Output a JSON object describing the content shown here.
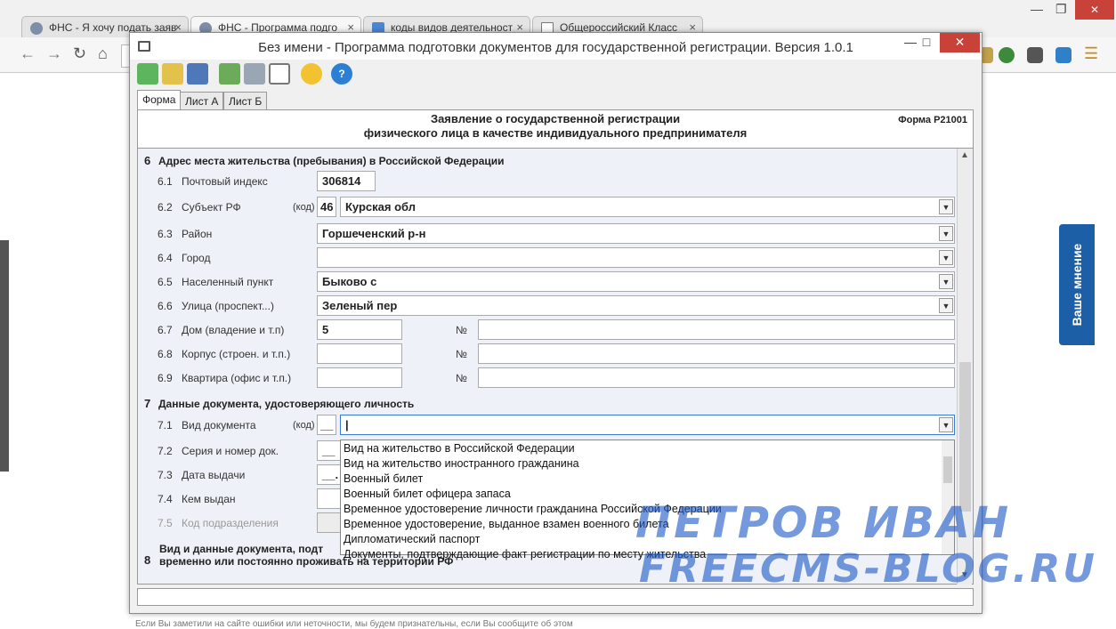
{
  "browser": {
    "tabs": [
      {
        "title": "ФНС - Я хочу подать заяв",
        "close": "×"
      },
      {
        "title": "ФНС - Программа подго",
        "close": "×"
      },
      {
        "title": "коды видов деятельност",
        "close": "×"
      },
      {
        "title": "Общероссийский Класс",
        "close": "×"
      }
    ],
    "window_controls": {
      "minimize": "—",
      "restore": "❐"
    }
  },
  "side_widget": {
    "label": "Ваше мнение"
  },
  "footer_note": "Если Вы заметили на сайте ошибки или неточности, мы будем признательны, если Вы сообщите об этом",
  "app": {
    "title": "Без имени - Программа подготовки документов для государственной регистрации. Версия 1.0.1",
    "window_buttons": {
      "minimize": "—",
      "maximize": "□",
      "close": "✕"
    },
    "tabs": [
      "Форма",
      "Лист А",
      "Лист Б"
    ],
    "form": {
      "title_line1": "Заявление о государственной регистрации",
      "title_line2": "физического лица в качестве индивидуального предпринимателя",
      "code": "Форма Р21001"
    },
    "section6": {
      "num": "6",
      "title": "Адрес места жительства (пребывания) в Российской Федерации",
      "rows": [
        {
          "num": "6.1",
          "label": "Почтовый индекс",
          "value": "306814"
        },
        {
          "num": "6.2",
          "label": "Субъект РФ",
          "kod_label": "(код)",
          "code": "46",
          "value": "Курская обл"
        },
        {
          "num": "6.3",
          "label": "Район",
          "value": "Горшеченский р-н"
        },
        {
          "num": "6.4",
          "label": "Город",
          "value": ""
        },
        {
          "num": "6.5",
          "label": "Населенный пункт",
          "value": "Быково с"
        },
        {
          "num": "6.6",
          "label": "Улица (проспект...)",
          "value": "Зеленый пер"
        },
        {
          "num": "6.7",
          "label": "Дом (владение и т.п)",
          "value": "5",
          "no_sign": "№",
          "no_value": ""
        },
        {
          "num": "6.8",
          "label": "Корпус (строен. и т.п.)",
          "value": "",
          "no_sign": "№",
          "no_value": ""
        },
        {
          "num": "6.9",
          "label": "Квартира (офис и т.п.)",
          "value": "",
          "no_sign": "№",
          "no_value": ""
        }
      ]
    },
    "section7": {
      "num": "7",
      "title": "Данные документа, удостоверяющего личность",
      "rows": [
        {
          "num": "7.1",
          "label": "Вид документа",
          "kod_label": "(код)",
          "code": "__",
          "value": ""
        },
        {
          "num": "7.2",
          "label": "Серия  и номер док.",
          "value": "__"
        },
        {
          "num": "7.3",
          "label": "Дата выдачи",
          "value": "__."
        },
        {
          "num": "7.4",
          "label": "Кем выдан",
          "value": ""
        },
        {
          "num": "7.5",
          "label": "Код подразделения",
          "value": ""
        }
      ],
      "dropdown_options": [
        "Вид на жительство в Российской Федерации",
        "Вид на жительство иностранного гражданина",
        "Военный билет",
        "Военный билет офицера запаса",
        "Временное удостоверение личности гражданина Российской Федерации",
        "Временное удостоверение, выданное взамен военного билета",
        "Дипломатический паспорт",
        "Документы, подтверждающие факт регистрации по месту жительства"
      ]
    },
    "section8": {
      "num": "8",
      "title_line1": "Вид и данные документа, подт",
      "title_line2": "временно или постоянно проживать на территории РФ"
    }
  },
  "watermark": {
    "line1": "ПЕТРОВ ИВАН",
    "line2": "FREECMS-BLOG.RU"
  }
}
